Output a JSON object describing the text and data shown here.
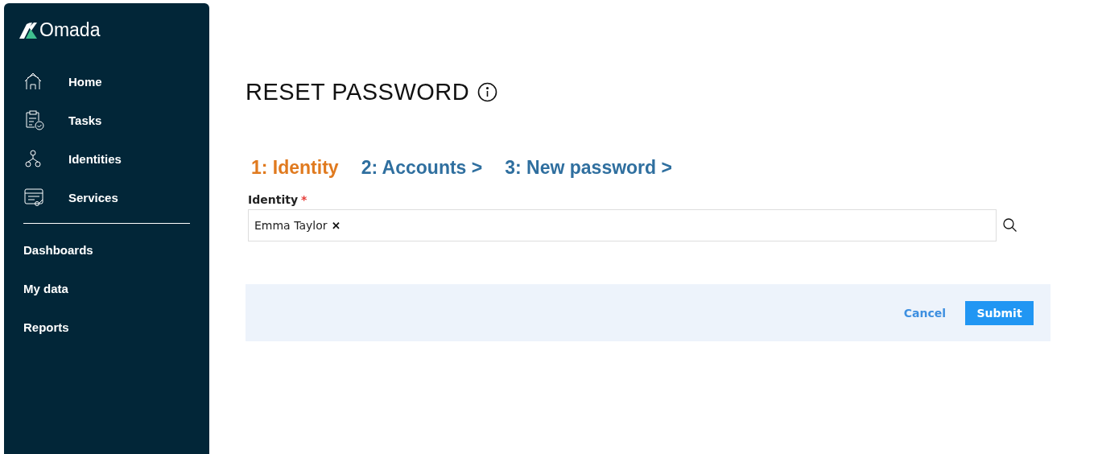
{
  "sidebar": {
    "brand": "Omada",
    "primary_items": [
      {
        "label": "Home"
      },
      {
        "label": "Tasks"
      },
      {
        "label": "Identities"
      },
      {
        "label": "Services"
      }
    ],
    "secondary_items": [
      {
        "label": "Dashboards"
      },
      {
        "label": "My data"
      },
      {
        "label": "Reports"
      }
    ]
  },
  "page": {
    "title": "RESET PASSWORD",
    "steps": [
      {
        "label": "1: Identity",
        "selected": true
      },
      {
        "label": "2: Accounts >",
        "selected": false
      },
      {
        "label": "3: New password >",
        "selected": false
      }
    ],
    "field": {
      "label": "Identity",
      "required_mark": "*",
      "chip": "Emma Taylor",
      "chip_remove": "✕"
    },
    "buttons": {
      "cancel": "Cancel",
      "submit": "Submit"
    }
  }
}
